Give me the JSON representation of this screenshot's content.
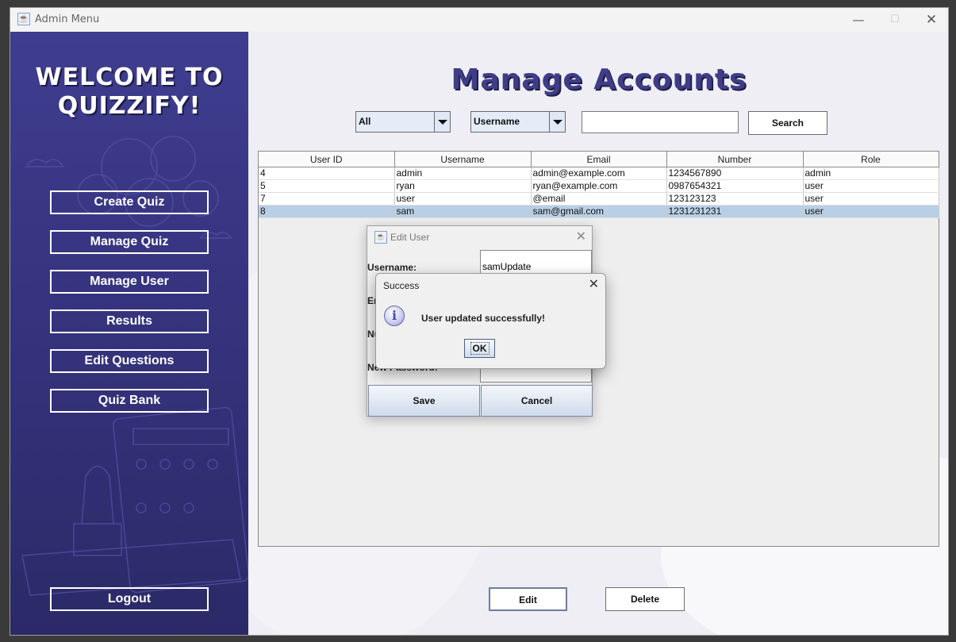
{
  "window": {
    "title": "Admin Menu"
  },
  "sidebar": {
    "welcome_line1": "WELCOME TO",
    "welcome_line2": "QUIZZIFY!",
    "buttons": [
      {
        "label": "Create Quiz"
      },
      {
        "label": "Manage Quiz"
      },
      {
        "label": "Manage User"
      },
      {
        "label": "Results"
      },
      {
        "label": "Edit Questions"
      },
      {
        "label": "Quiz Bank"
      }
    ],
    "logout_label": "Logout"
  },
  "main": {
    "heading": "Manage Accounts",
    "filter_role": "All",
    "filter_field": "Username",
    "search_value": "",
    "search_label": "Search",
    "edit_label": "Edit",
    "delete_label": "Delete"
  },
  "table": {
    "headers": [
      "User ID",
      "Username",
      "Email",
      "Number",
      "Role"
    ],
    "rows": [
      [
        "4",
        "admin",
        "admin@example.com",
        "1234567890",
        "admin"
      ],
      [
        "5",
        "ryan",
        "ryan@example.com",
        "0987654321",
        "user"
      ],
      [
        "7",
        "user",
        "@email",
        "123123123",
        "user"
      ],
      [
        "8",
        "sam",
        "sam@gmail.com",
        "1231231231",
        "user"
      ]
    ],
    "selected_row_index": 3
  },
  "edit_dialog": {
    "title": "Edit User",
    "username_label": "Username:",
    "username_value": "samUpdate",
    "email_label_visible": "Em",
    "number_label_visible": "Nu",
    "password_label_visible": "New Password:",
    "save_label": "Save",
    "cancel_label": "Cancel"
  },
  "success_dialog": {
    "title": "Success",
    "message": "User updated successfully!",
    "ok_label": "OK"
  },
  "colors": {
    "sidebar": "#3f3d8f",
    "heading": "#3f3d87",
    "selected_row": "#b8cfe5"
  }
}
